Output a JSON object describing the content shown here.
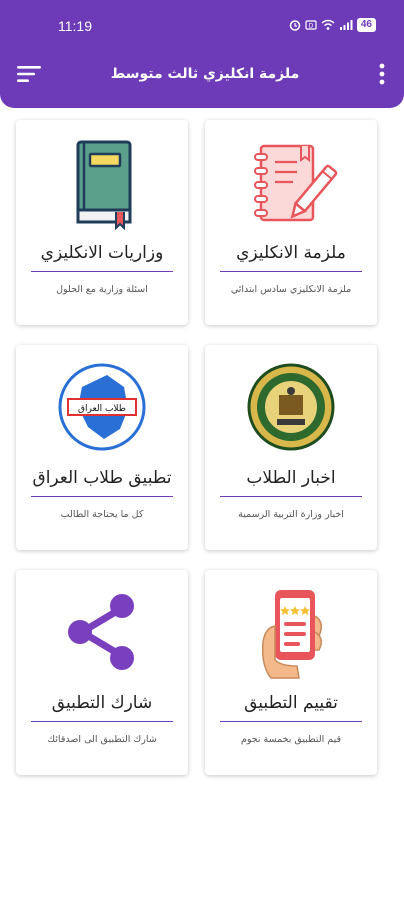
{
  "status_bar": {
    "time": "11:19",
    "battery": "46"
  },
  "app_bar": {
    "title": "ملزمة انكليزي ثالث متوسط"
  },
  "cards": [
    {
      "title": "ملزمة الانكليزي",
      "subtitle": "ملزمة الانكليزي سادس ابتدائي",
      "icon": "notebook-pen-icon"
    },
    {
      "title": "وزاريات الانكليزي",
      "subtitle": "اسئلة وزارية مع الحلول",
      "icon": "book-icon"
    },
    {
      "title": "اخبار الطلاب",
      "subtitle": "اخبار وزارة التربية الرسمية",
      "icon": "ministry-emblem-icon"
    },
    {
      "title": "تطبيق طلاب العراق",
      "subtitle": "كل ما يحتاجة الطالب",
      "icon": "iraq-students-logo-icon",
      "logo_text": "طلاب العراق"
    },
    {
      "title": "تقييم التطبيق",
      "subtitle": "قيم التطبيق بخمسة نجوم",
      "icon": "rate-phone-icon"
    },
    {
      "title": "شارك التطبيق",
      "subtitle": "شارك التطبيق الى اصدقائك",
      "icon": "share-icon"
    }
  ],
  "colors": {
    "primary": "#6d3bb8",
    "pink": "#e8555a",
    "teal": "#5aa08a"
  }
}
